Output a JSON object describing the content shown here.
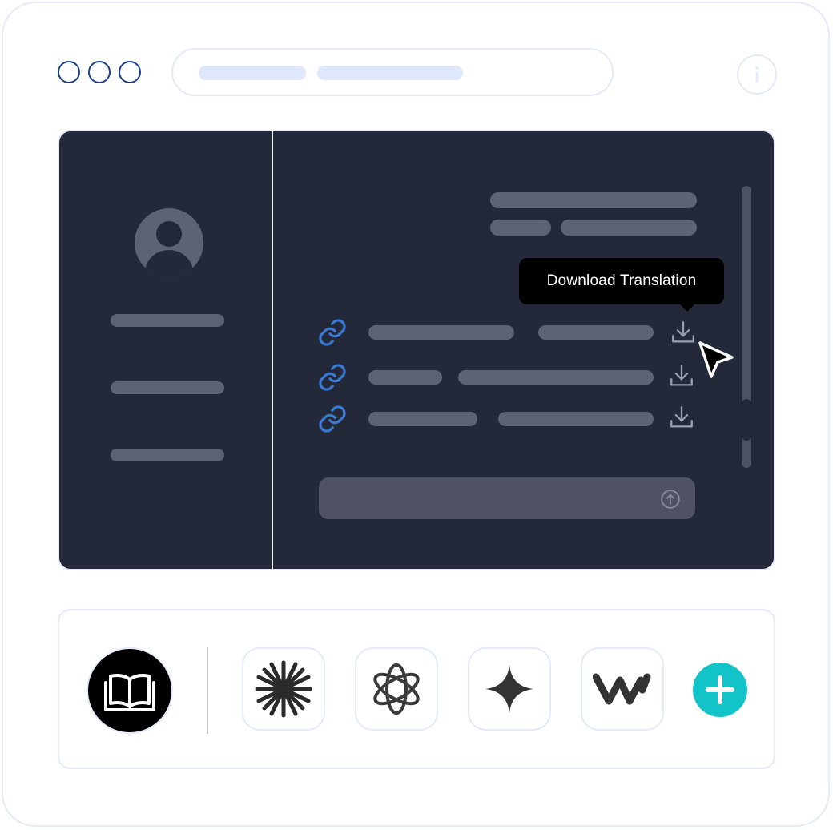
{
  "browser": {
    "window_controls": [
      "window-dot",
      "window-dot",
      "window-dot"
    ],
    "info_icon": "info-icon"
  },
  "app": {
    "tooltip": {
      "text": "Download Translation"
    },
    "file_rows": [
      {
        "link_icon": "link-icon",
        "download_icon": "download-icon"
      },
      {
        "link_icon": "link-icon",
        "download_icon": "download-icon"
      },
      {
        "link_icon": "link-icon",
        "download_icon": "download-icon"
      }
    ],
    "send_icon": "arrow-up-circle-icon"
  },
  "dock": {
    "items": [
      "open-book-icon",
      "claude-icon",
      "openai-icon",
      "gemini-icon",
      "wordtune-icon",
      "plus-icon"
    ]
  },
  "colors": {
    "app_bg": "#232939",
    "accent_link": "#3a7bd5",
    "add_button": "#12c3c8",
    "border": "#e3eafb",
    "window_dot": "#1b3f8b"
  }
}
